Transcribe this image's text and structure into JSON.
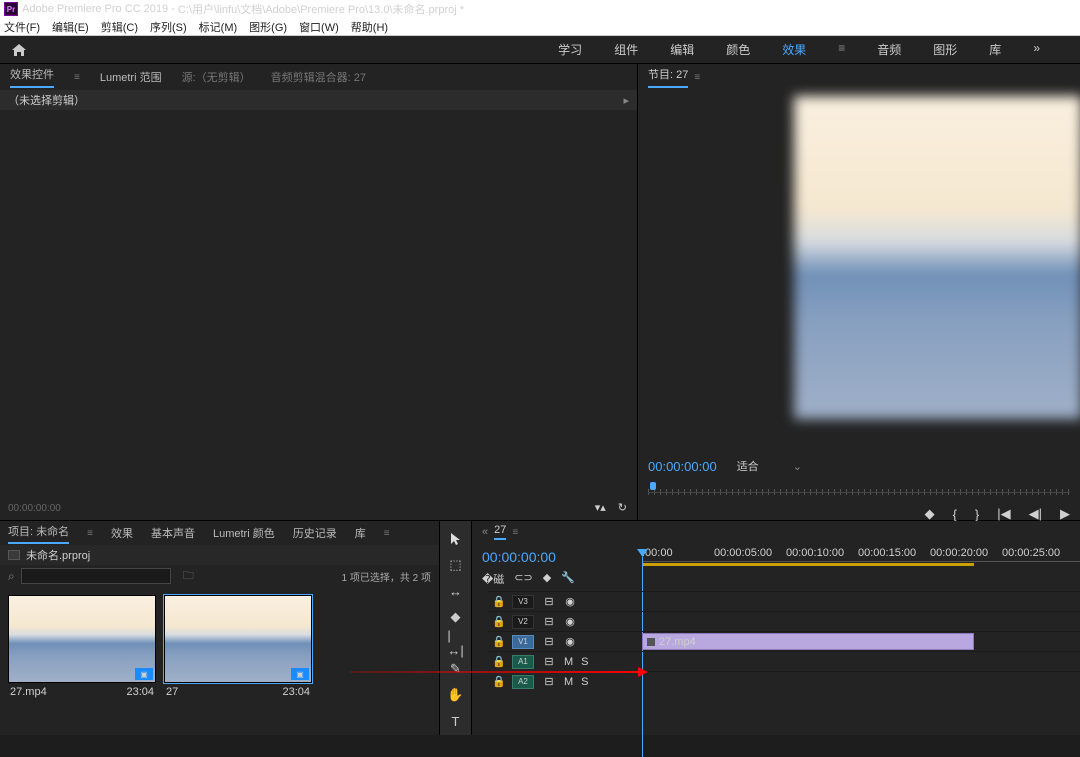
{
  "titlebar": {
    "app": "Adobe Premiere Pro CC 2019",
    "path": "C:\\用户\\linfu\\文档\\Adobe\\Premiere Pro\\13.0\\未命名.prproj *"
  },
  "menu": {
    "file": "文件(F)",
    "edit": "编辑(E)",
    "clip": "剪辑(C)",
    "sequence": "序列(S)",
    "marker": "标记(M)",
    "graphics": "图形(G)",
    "window": "窗口(W)",
    "help": "帮助(H)"
  },
  "workspace": {
    "learn": "学习",
    "assembly": "组件",
    "editing": "编辑",
    "color": "颜色",
    "effects": "效果",
    "audio": "音频",
    "graphics": "图形",
    "library": "库",
    "overflow": "»"
  },
  "left_panel": {
    "tabs": {
      "effect_controls": "效果控件",
      "lumetri": "Lumetri 范围",
      "source": "源:（无剪辑）",
      "audio_mixer": "音频剪辑混合器: 27"
    },
    "no_clip": "（未选择剪辑）",
    "tc": "00:00:00:00"
  },
  "program": {
    "label": "节目: 27",
    "tc": "00:00:00:00",
    "fit": "适合"
  },
  "transport": {
    "mark": "◆",
    "in": "{",
    "out": "}",
    "goto": "|◀",
    "step_back": "◀|",
    "play": "▶"
  },
  "project": {
    "tabs": {
      "project": "项目: 未命名",
      "effects": "效果",
      "essential_sound": "基本声音",
      "lumetri": "Lumetri 颜色",
      "history": "历史记录",
      "libraries": "库"
    },
    "bin": "未命名.prproj",
    "status": "1 项已选择，共 2 项",
    "items": [
      {
        "name": "27.mp4",
        "dur": "23:04"
      },
      {
        "name": "27",
        "dur": "23:04"
      }
    ]
  },
  "tools": {
    "select": "▲",
    "track": "⬚",
    "ripple": "↔",
    "razor": "◆",
    "slip": "|↔|",
    "pen": "✎",
    "hand": "✋",
    "type": "T"
  },
  "timeline": {
    "seq": "27",
    "tc": "00:00:00:00",
    "ruler": [
      ":00:00",
      "00:00:05:00",
      "00:00:10:00",
      "00:00:15:00",
      "00:00:20:00",
      "00:00:25:00"
    ],
    "tracks": {
      "v3": "V3",
      "v2": "V2",
      "v1": "V1",
      "a1": "A1",
      "a2": "A2"
    },
    "clip": "27.mp4"
  }
}
